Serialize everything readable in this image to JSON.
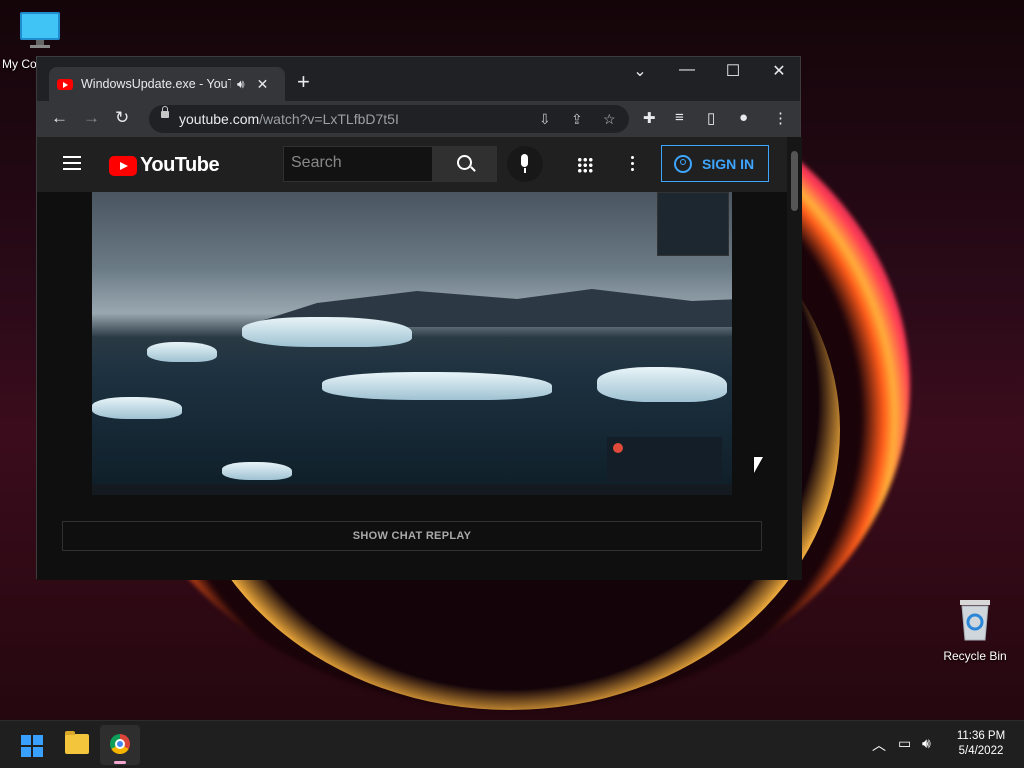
{
  "desktop": {
    "icons": [
      {
        "label": "My Co"
      },
      {
        "label": "Recycle Bin"
      }
    ]
  },
  "browser": {
    "tab": {
      "title": "WindowsUpdate.exe - YouTu"
    },
    "address": {
      "host": "youtube.com",
      "path": "/watch?v=LxTLfbD7t5I"
    }
  },
  "youtube": {
    "logo_text": "YouTube",
    "search_placeholder": "Search",
    "signin_label": "SIGN IN",
    "chat_replay_label": "SHOW CHAT REPLAY"
  },
  "taskbar": {
    "time": "11:36 PM",
    "date": "5/4/2022"
  },
  "colors": {
    "accent": "#3ea6ff",
    "youtube_red": "#ff0000"
  }
}
